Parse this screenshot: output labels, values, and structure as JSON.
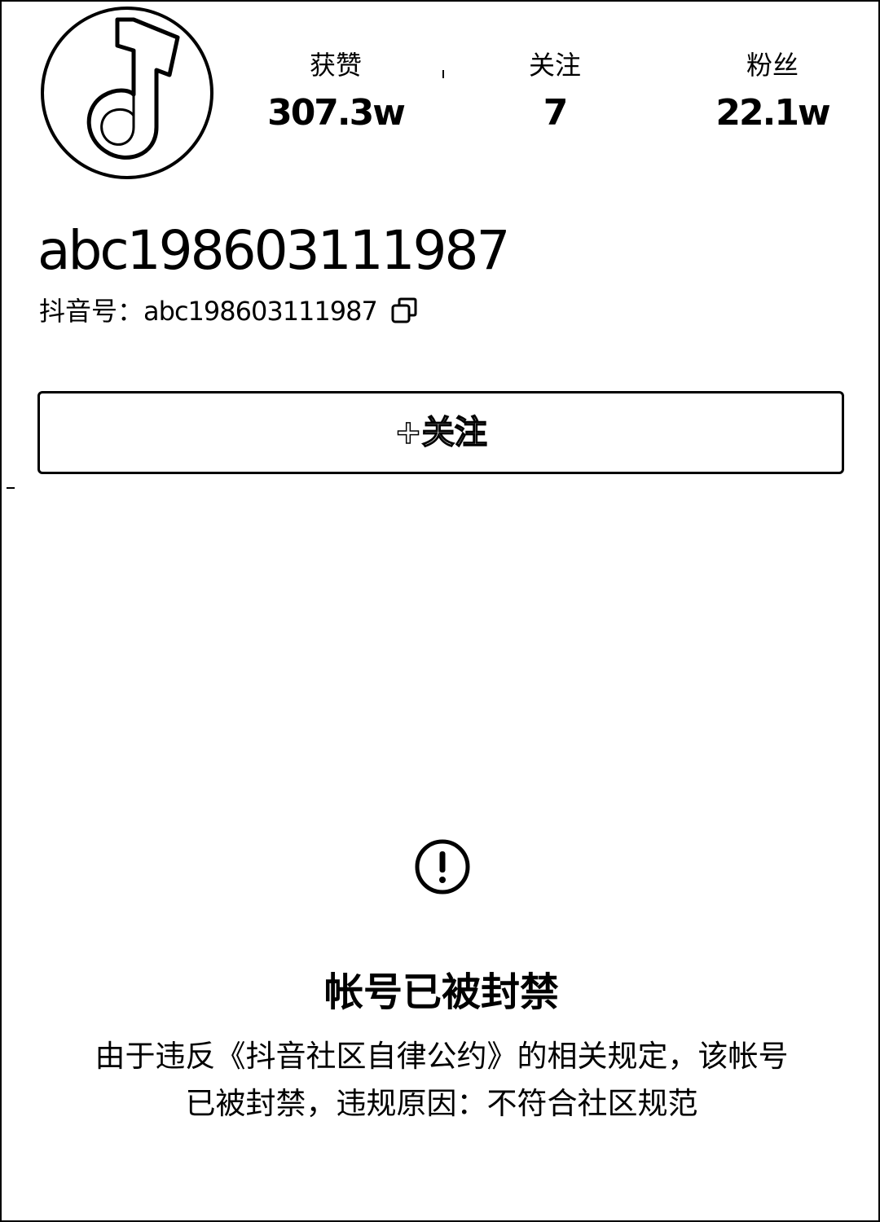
{
  "profile": {
    "avatar_icon": "music-note-icon",
    "username": "abc198603111987",
    "account_id_label": "抖音号：",
    "account_id_value": "abc198603111987",
    "copy_icon": "copy-icon"
  },
  "stats": {
    "likes": {
      "label": "获赞",
      "value": "307.3w"
    },
    "following": {
      "label": "关注",
      "value": "7"
    },
    "fans": {
      "label": "粉丝",
      "value": "22.1w"
    }
  },
  "follow_button": {
    "label": "+关注"
  },
  "ban_notice": {
    "icon": "exclamation-circle-icon",
    "title": "帐号已被封禁",
    "message_line1": "由于违反《抖音社区自律公约》的相关规定，该帐号",
    "message_line2": "已被封禁，违规原因：不符合社区规范"
  },
  "colors": {
    "foreground": "#000000",
    "background": "#ffffff"
  }
}
